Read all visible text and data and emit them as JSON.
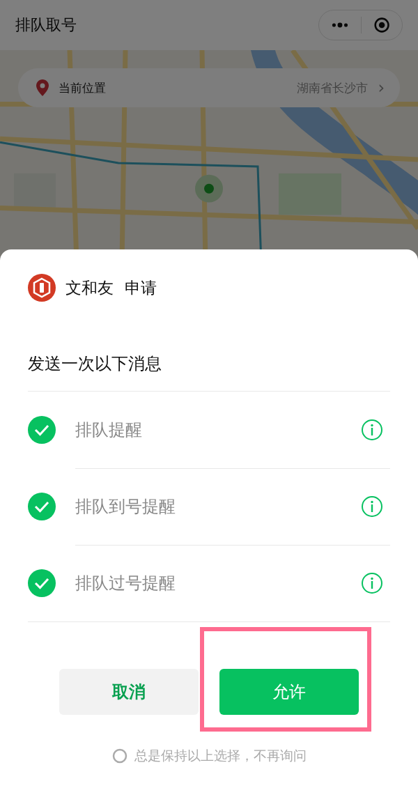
{
  "header": {
    "title": "排队取号"
  },
  "location": {
    "label": "当前位置",
    "value": "湖南省长沙市",
    "chevron": "›"
  },
  "dialog": {
    "app_name": "文和友",
    "action": "申请",
    "prompt": "发送一次以下消息",
    "items": [
      {
        "label": "排队提醒",
        "checked": true
      },
      {
        "label": "排队到号提醒",
        "checked": true
      },
      {
        "label": "排队过号提醒",
        "checked": true
      }
    ],
    "cancel": "取消",
    "allow": "允许",
    "allow_highlighted": true,
    "remember": {
      "label": "总是保持以上选择，不再询问",
      "checked": false
    }
  }
}
